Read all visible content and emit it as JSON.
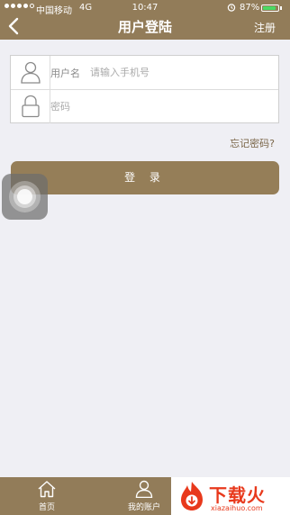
{
  "status_bar": {
    "carrier": "中国移动",
    "network": "4G",
    "time": "10:47",
    "battery_percent": "87%",
    "battery_level": 0.87,
    "battery_color": "#4cd964"
  },
  "nav": {
    "title": "用户登陆",
    "right_action": "注册",
    "back_icon": "chevron-left-icon",
    "background": "#927c59"
  },
  "form": {
    "username": {
      "label": "用户名",
      "placeholder": "请输入手机号",
      "value": "",
      "icon": "user-icon"
    },
    "password": {
      "placeholder": "密码",
      "value": "",
      "icon": "lock-icon"
    }
  },
  "forgot_link": "忘记密码?",
  "login_button": "登 录",
  "tab_bar": {
    "items": [
      {
        "label": "首页",
        "icon": "home-icon"
      },
      {
        "label": "我的账户",
        "icon": "person-icon"
      }
    ]
  },
  "watermark": {
    "text": "下载火",
    "url": "xiazaihuo.com",
    "color": "#e8391c"
  }
}
